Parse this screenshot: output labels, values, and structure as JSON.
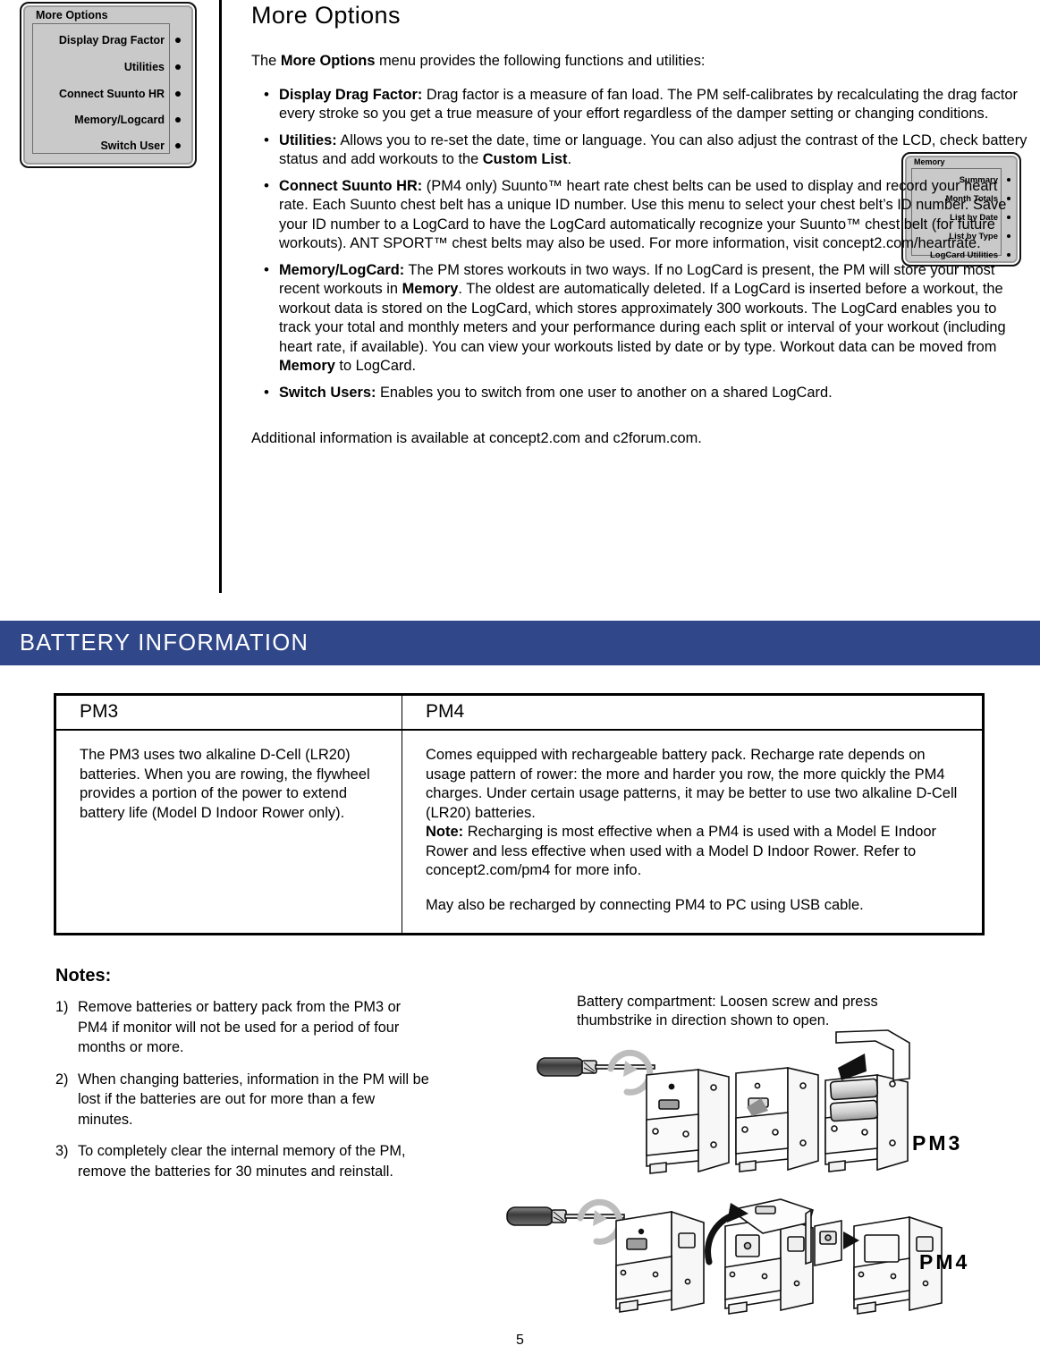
{
  "lcd_more_options": {
    "title": "More Options",
    "items": [
      "Display Drag Factor",
      "Utilities",
      "Connect Suunto HR",
      "Memory/Logcard",
      "Switch User"
    ]
  },
  "lcd_memory": {
    "title": "Memory",
    "items": [
      "Summary",
      "Month Totals",
      "List by Date",
      "List by Type",
      "LogCard Utilities"
    ]
  },
  "article": {
    "heading": "More Options",
    "intro": {
      "before": "The ",
      "term": "More Options",
      "after": " menu provides the following functions and utilities:"
    },
    "bullets": [
      {
        "term": "Display Drag Factor:",
        "body": " Drag factor is a measure of fan load. The PM self-calibrates by recalculating the drag factor every stroke so you get a true measure of your effort regardless of the damper setting or changing conditions."
      },
      {
        "term": "Utilities:",
        "body": " Allows you to re-set the date, time or language. You can also adjust the contrast of the LCD, check battery status and add workouts to the ",
        "body_bold": "Custom List",
        "body_tail": "."
      },
      {
        "term": "Connect Suunto HR:",
        "body": " (PM4 only) Suunto™ heart rate chest belts can be used to display and record your heart rate. Each Suunto chest belt has a unique ID number. Use this menu to select your chest belt’s ID number. Save your ID number to a LogCard to have the LogCard automatically recognize your Suunto™ chest belt (for future workouts). ANT SPORT™ chest belts may also be used. For more information, visit concept2.com/heartrate."
      },
      {
        "term": "Memory/LogCard:",
        "body": " The PM stores workouts in two ways. If no LogCard is present, the PM will store your most recent workouts in ",
        "body_bold": "Memory",
        "body_tail": ". The oldest are automatically deleted. If a LogCard is inserted before a workout, the workout data is stored on the LogCard, which stores approximately 300 workouts. The LogCard enables you to track your total and monthly meters and your performance during each split or interval of your workout (including heart rate, if available). You can view your workouts listed by date or by type. Workout data can be moved from ",
        "body_bold2": "Memory",
        "body_tail2": " to LogCard."
      },
      {
        "term": "Switch Users:",
        "body": " Enables you to switch from one user to another on a shared LogCard."
      }
    ],
    "closing": "Additional information is available at concept2.com and c2forum.com."
  },
  "battery_section": {
    "banner_title": "BATTERY INFORMATION",
    "table": {
      "headers": [
        "PM3",
        "PM4"
      ],
      "pm3_cell": "The PM3 uses two alkaline D-Cell (LR20) batteries. When you are rowing, the flywheel provides a portion of the power to extend battery life (Model D Indoor Rower only).",
      "pm4_para1_a": "Comes equipped with rechargeable battery pack. Recharge rate depends on usage pattern of rower: the more and harder you row, the more quickly the PM4 charges. Under certain usage patterns, it may be better to use two alkaline D-Cell (LR20) batteries.",
      "pm4_note_label": "Note:",
      "pm4_note_body": " Recharging is most effective when a PM4 is used with a Model E Indoor Rower and less effective when used with a Model D Indoor Rower. Refer to concept2.com/pm4 for more info.",
      "pm4_para2": "May also be recharged by connecting PM4 to PC using USB cable."
    }
  },
  "notes": {
    "heading": "Notes:",
    "items": [
      {
        "number": "1)",
        "text": "Remove batteries or battery pack from the PM3 or PM4 if monitor will not be used for a period of four months or more."
      },
      {
        "number": "2)",
        "text": "When changing batteries, information in the PM will be lost if the batteries are out for more than a few minutes."
      },
      {
        "number": "3)",
        "text": "To completely clear the internal memory of the PM, remove the batteries for 30 minutes and reinstall."
      }
    ]
  },
  "illustration": {
    "caption": "Battery compartment: Loosen screw and press thumbstrike in direction shown to open.",
    "pm3_label": "PM3",
    "pm4_label": "PM4"
  },
  "page_number": "5",
  "colors": {
    "banner": "#30488a",
    "lcd_body": "#c9c9c9",
    "text": "#000000"
  }
}
